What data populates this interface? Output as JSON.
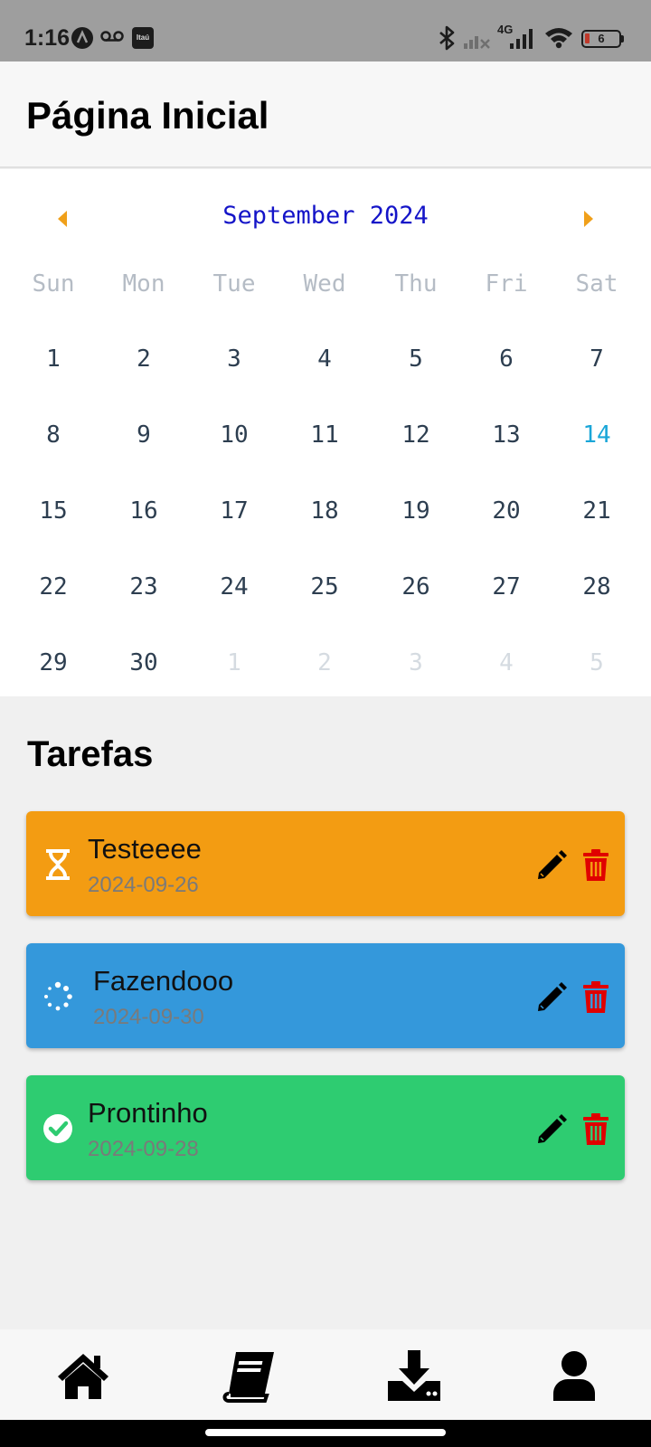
{
  "status_bar": {
    "time": "1:16",
    "battery": "6",
    "network": "4G",
    "icons": [
      "app-a-icon",
      "voicemail-icon",
      "itau-app-icon",
      "bluetooth-icon",
      "signal-off-icon",
      "signal-4g-icon",
      "wifi-icon",
      "battery-icon"
    ],
    "itau_label": "Itaú"
  },
  "header": {
    "title": "Página Inicial"
  },
  "calendar": {
    "month_label": "September 2024",
    "prev_icon": "caret-left-icon",
    "next_icon": "caret-right-icon",
    "arrow_color": "#f0a01a",
    "month_color": "#1414c8",
    "today_color": "#1aa6d8",
    "weekdays": [
      "Sun",
      "Mon",
      "Tue",
      "Wed",
      "Thu",
      "Fri",
      "Sat"
    ],
    "weeks": [
      [
        "1",
        "2",
        "3",
        "4",
        "5",
        "6",
        "7"
      ],
      [
        "8",
        "9",
        "10",
        "11",
        "12",
        "13",
        "14"
      ],
      [
        "15",
        "16",
        "17",
        "18",
        "19",
        "20",
        "21"
      ],
      [
        "22",
        "23",
        "24",
        "25",
        "26",
        "27",
        "28"
      ],
      [
        "29",
        "30",
        "1",
        "2",
        "3",
        "4",
        "5"
      ]
    ],
    "today": "14",
    "trailing_other_month_days": [
      "1",
      "2",
      "3",
      "4",
      "5"
    ]
  },
  "tasks": {
    "title": "Tarefas",
    "items": [
      {
        "title": "Testeeee",
        "date": "2024-09-26",
        "status": "pending",
        "status_icon": "hourglass-icon",
        "color": "#f39c12"
      },
      {
        "title": "Fazendooo",
        "date": "2024-09-30",
        "status": "in-progress",
        "status_icon": "spinner-icon",
        "color": "#3498db"
      },
      {
        "title": "Prontinho",
        "date": "2024-09-28",
        "status": "done",
        "status_icon": "check-circle-icon",
        "color": "#2ecc71"
      }
    ],
    "edit_icon": "pencil-icon",
    "delete_icon": "trash-icon",
    "delete_color": "#e00000"
  },
  "bottom_nav": {
    "items": [
      {
        "name": "home",
        "icon": "home-icon"
      },
      {
        "name": "book",
        "icon": "book-icon"
      },
      {
        "name": "download",
        "icon": "download-icon"
      },
      {
        "name": "profile",
        "icon": "user-icon"
      }
    ]
  }
}
